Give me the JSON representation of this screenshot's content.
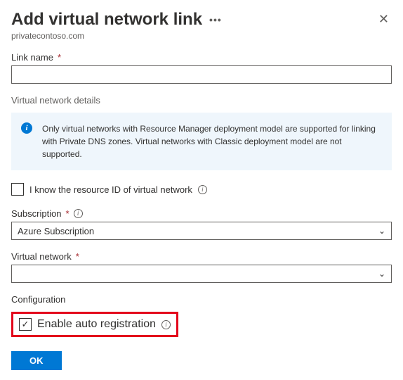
{
  "header": {
    "title": "Add virtual network link",
    "breadcrumb": "privatecontoso.com"
  },
  "link_name": {
    "label": "Link name",
    "value": ""
  },
  "vnet_section_title": "Virtual network details",
  "info_box": "Only virtual networks with Resource Manager deployment model are supported for linking with Private DNS zones. Virtual networks with Classic deployment model are not supported.",
  "know_resource_id": {
    "label": "I know the resource ID of virtual network",
    "checked": false
  },
  "subscription": {
    "label": "Subscription",
    "value": "Azure Subscription"
  },
  "virtual_network": {
    "label": "Virtual network",
    "value": ""
  },
  "configuration": {
    "title": "Configuration",
    "auto_reg_label": "Enable auto registration",
    "auto_reg_checked": true
  },
  "ok_label": "OK"
}
